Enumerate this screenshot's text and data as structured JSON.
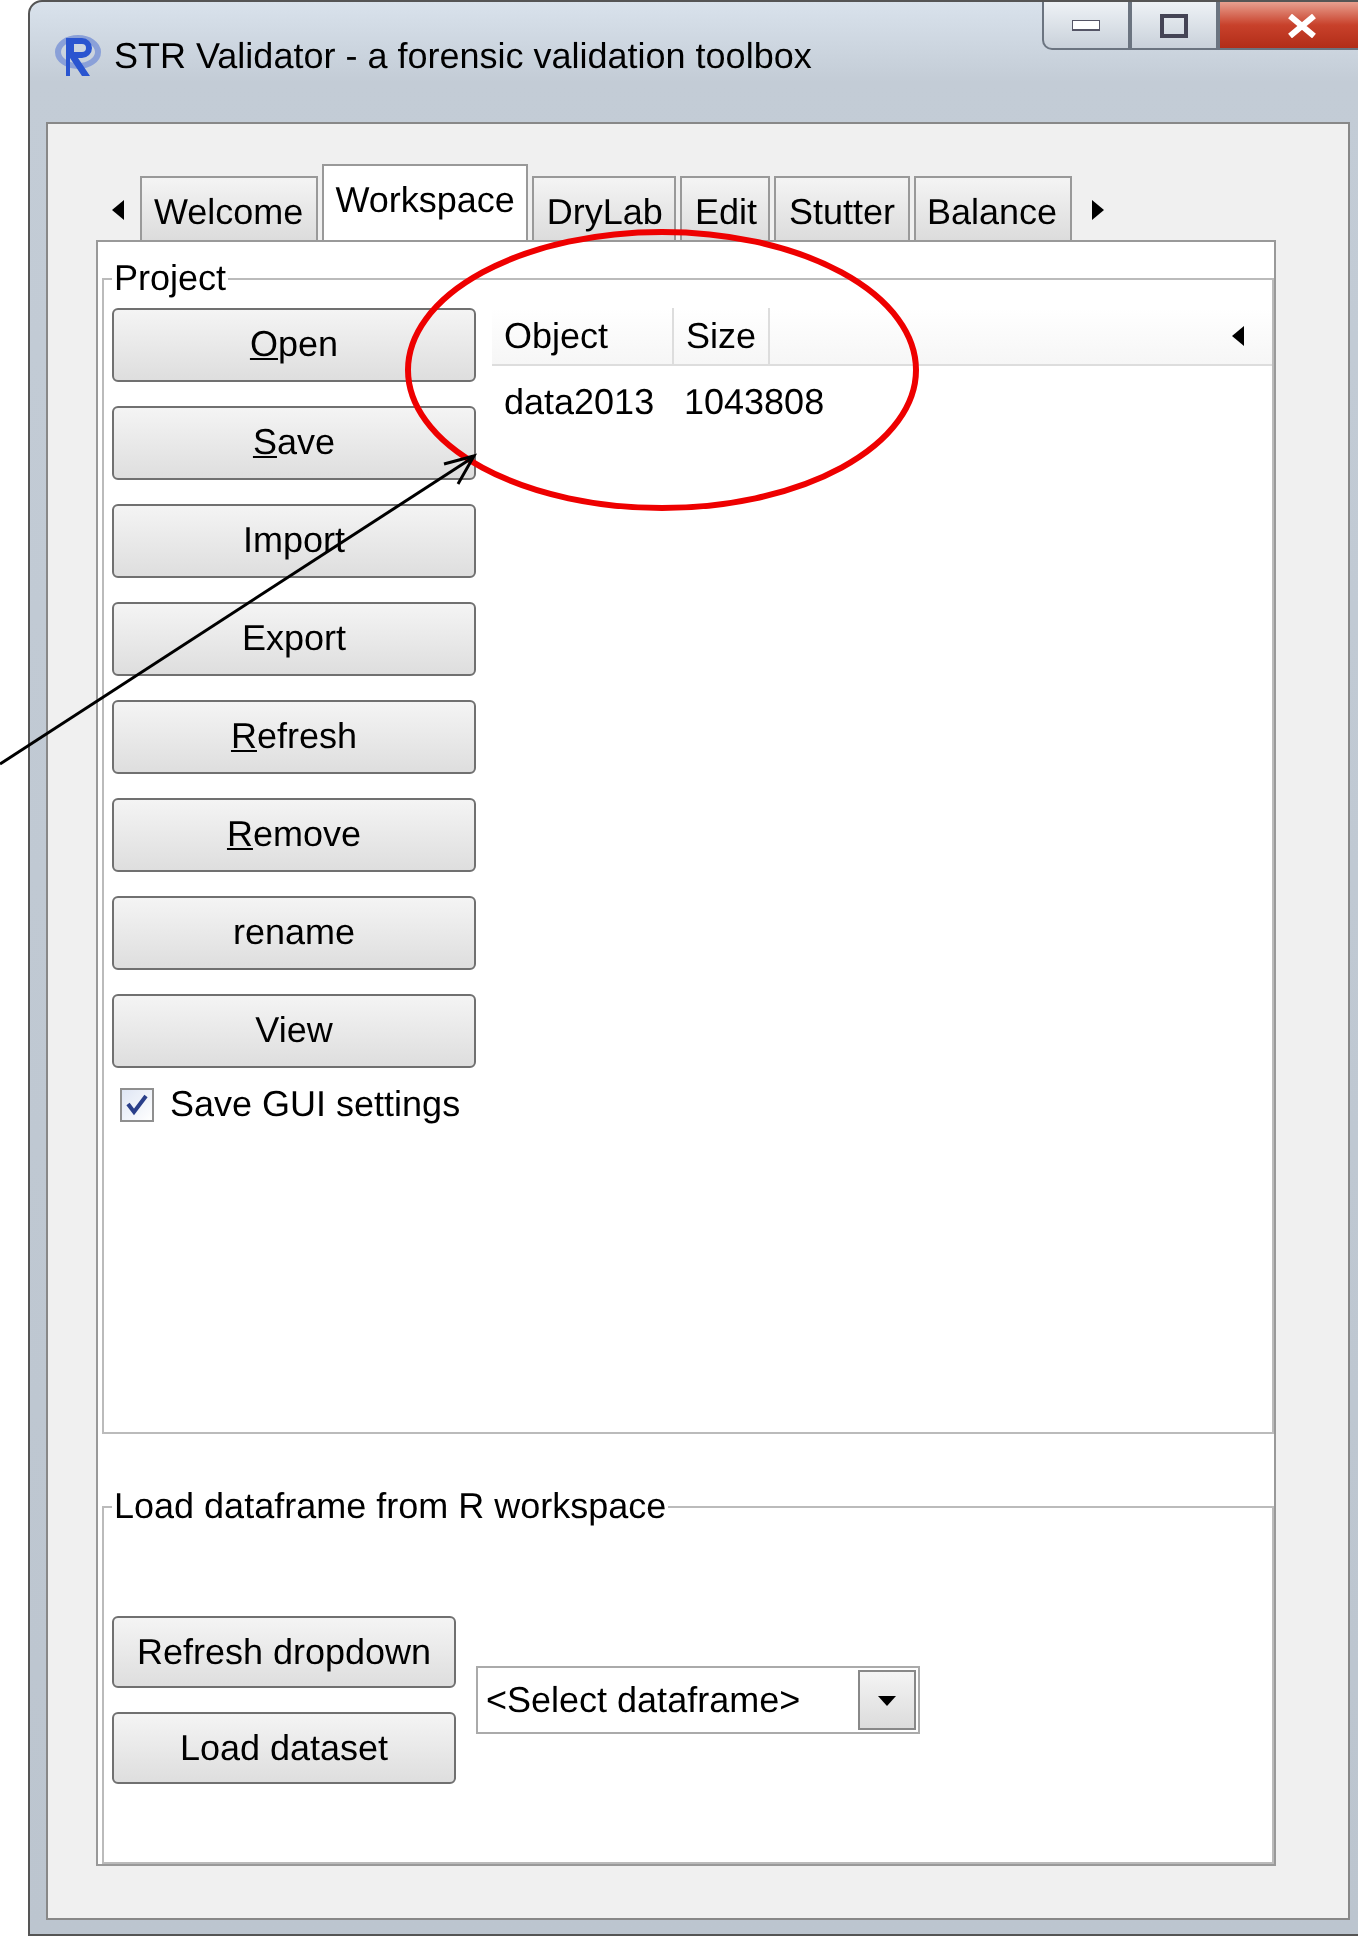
{
  "window": {
    "title": "STR Validator - a forensic validation toolbox"
  },
  "tabs": [
    {
      "label": "Welcome",
      "selected": false
    },
    {
      "label": "Workspace",
      "selected": true
    },
    {
      "label": "DryLab",
      "selected": false
    },
    {
      "label": "Edit",
      "selected": false
    },
    {
      "label": "Stutter",
      "selected": false
    },
    {
      "label": "Balance",
      "selected": false
    }
  ],
  "project": {
    "title": "Project",
    "buttons": [
      {
        "label": "Open",
        "mnemonic": true
      },
      {
        "label": "Save",
        "mnemonic": true
      },
      {
        "label": "Import",
        "mnemonic": false
      },
      {
        "label": "Export",
        "mnemonic": false
      },
      {
        "label": "Refresh",
        "mnemonic": true
      },
      {
        "label": "Remove",
        "mnemonic": true
      },
      {
        "label": "rename",
        "mnemonic": false
      },
      {
        "label": "View",
        "mnemonic": false
      }
    ],
    "checkbox": {
      "label": "Save GUI settings",
      "checked": true
    },
    "table": {
      "columns": [
        "Object",
        "Size"
      ],
      "rows": [
        [
          "data2013",
          "1043808"
        ]
      ]
    }
  },
  "load": {
    "title": "Load dataframe from R workspace",
    "buttons": [
      "Refresh dropdown",
      "Load dataset"
    ],
    "dropdown": {
      "value": "<Select dataframe>"
    }
  }
}
